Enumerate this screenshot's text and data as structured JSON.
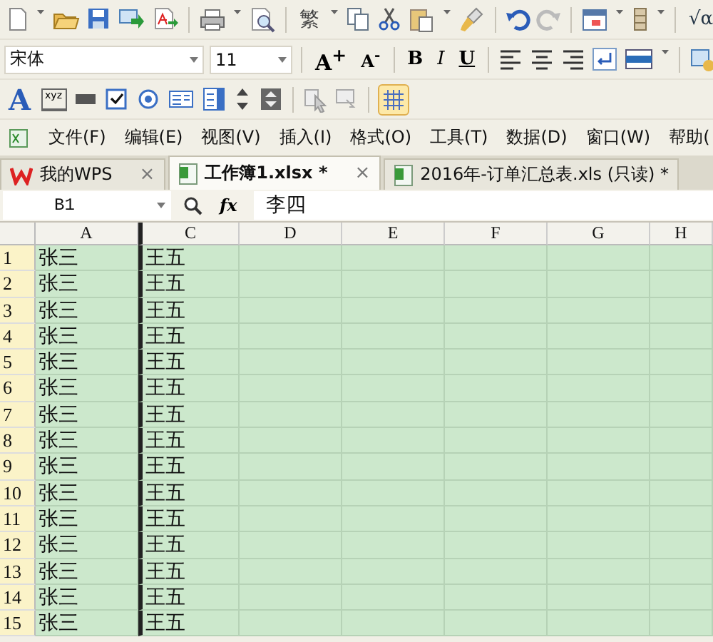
{
  "toolbar": {
    "traditional_glyph": "繁",
    "formula_glyph": "√α"
  },
  "format_bar": {
    "font": "宋体",
    "size": "11",
    "grow": "A$^{+}$",
    "shrink": "A$^{-}$",
    "bold": "B",
    "italic": "I",
    "underline": "U"
  },
  "forms_bar": {
    "wordart": "A",
    "label_tool": "xyz",
    "gridlines_on": true
  },
  "menu": [
    "文件(F)",
    "编辑(E)",
    "视图(V)",
    "插入(I)",
    "格式(O)",
    "工具(T)",
    "数据(D)",
    "窗口(W)",
    "帮助("
  ],
  "tabs": [
    {
      "kind": "home",
      "label": "我的WPS",
      "close": "×",
      "selected": false
    },
    {
      "kind": "sheet",
      "label": "工作簿1.xlsx *",
      "close": "×",
      "selected": true
    },
    {
      "kind": "sheet",
      "label": "2016年-订单汇总表.xls (只读) *",
      "selected": false
    }
  ],
  "formula_bar": {
    "cell": "B1",
    "fx": "fx",
    "value": "李四"
  },
  "columns": [
    "A",
    "C",
    "D",
    "E",
    "F",
    "G",
    "H"
  ],
  "rows": [
    {
      "number": "1",
      "cells": [
        "张三",
        "王五"
      ]
    },
    {
      "number": "2",
      "cells": [
        "张三",
        "王五"
      ]
    },
    {
      "number": "3",
      "cells": [
        "张三",
        "王五"
      ]
    },
    {
      "number": "4",
      "cells": [
        "张三",
        "王五"
      ]
    },
    {
      "number": "5",
      "cells": [
        "张三",
        "王五"
      ]
    },
    {
      "number": "6",
      "cells": [
        "张三",
        "王五"
      ]
    },
    {
      "number": "7",
      "cells": [
        "张三",
        "王五"
      ]
    },
    {
      "number": "8",
      "cells": [
        "张三",
        "王五"
      ]
    },
    {
      "number": "9",
      "cells": [
        "张三",
        "王五"
      ]
    },
    {
      "number": "10",
      "cells": [
        "张三",
        "王五"
      ]
    },
    {
      "number": "11",
      "cells": [
        "张三",
        "王五"
      ]
    },
    {
      "number": "12",
      "cells": [
        "张三",
        "王五"
      ]
    },
    {
      "number": "13",
      "cells": [
        "张三",
        "王五"
      ]
    },
    {
      "number": "14",
      "cells": [
        "张三",
        "王五"
      ]
    },
    {
      "number": "15",
      "cells": [
        "张三",
        "王五"
      ]
    }
  ]
}
